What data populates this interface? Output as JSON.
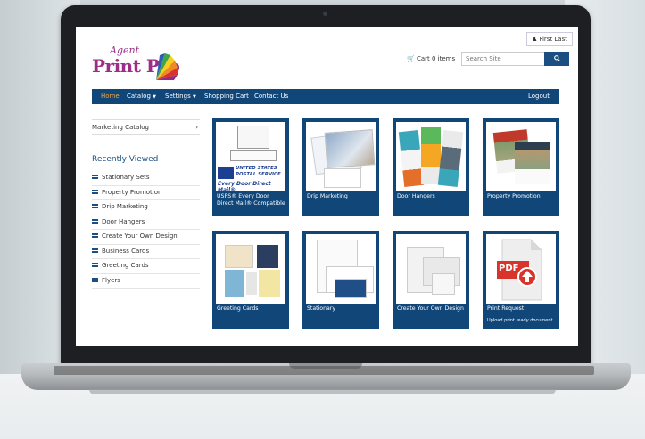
{
  "topbar": {
    "user_label": "First Last",
    "user_icon": "user-icon"
  },
  "logo": {
    "agent": "Agent",
    "main": "Print Pro"
  },
  "header": {
    "cart_label": "Cart 0 items",
    "cart_icon": "cart-icon",
    "search_placeholder": "Search Site",
    "search_icon": "search-icon"
  },
  "nav": {
    "home": "Home",
    "catalog": "Catalog",
    "settings": "Settings",
    "shopping_cart": "Shopping Cart",
    "contact": "Contact Us",
    "logout": "Logout"
  },
  "sidebar": {
    "catalog_label": "Marketing Catalog",
    "catalog_arrow": "›",
    "recently_title": "Recently Viewed",
    "items": [
      "Stationary Sets",
      "Property Promotion",
      "Drip Marketing",
      "Door Hangers",
      "Create Your Own Design",
      "Business Cards",
      "Greeting Cards",
      "Flyers"
    ]
  },
  "tiles": [
    {
      "label": "USPS® Every Door Direct Mail® Compatible",
      "usps_line1": "UNITED STATES",
      "usps_line2": "POSTAL SERVICE",
      "usps_line3": "Every Door Direct Mail®"
    },
    {
      "label": "Drip Marketing"
    },
    {
      "label": "Door Hangers"
    },
    {
      "label": "Property Promotion"
    },
    {
      "label": "Greeting Cards"
    },
    {
      "label": "Stationary"
    },
    {
      "label": "Create Your Own Design"
    },
    {
      "label": "Print Request",
      "sublabel": "Upload print ready document",
      "pdf_text": "PDF"
    }
  ],
  "colors": {
    "nav_blue": "#114679",
    "accent_orange": "#f0a63c",
    "brand_purple": "#9b2e86"
  }
}
